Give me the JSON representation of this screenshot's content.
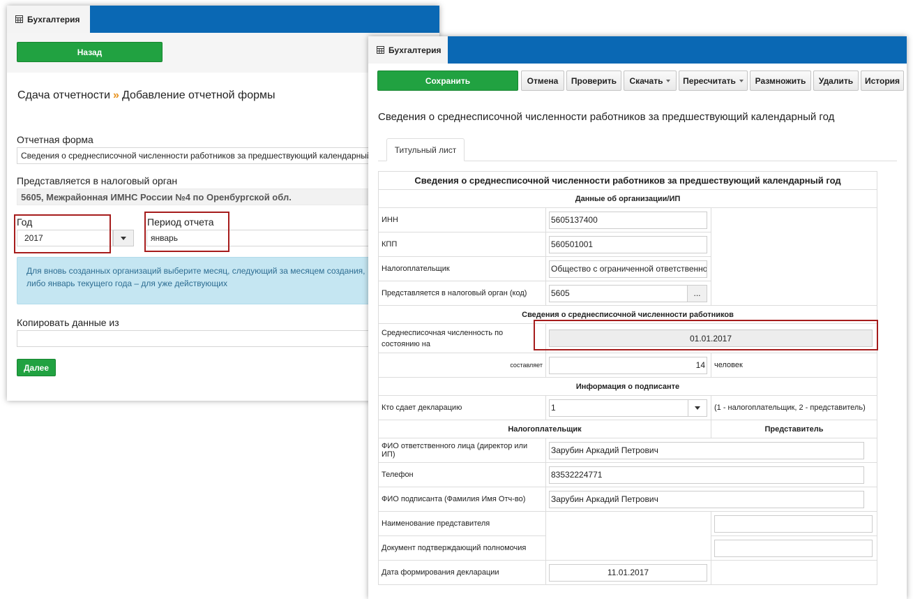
{
  "back_window": {
    "app_name": "Бухгалтерия",
    "back_button": "Назад",
    "breadcrumb": {
      "parent": "Сдача отчетности",
      "separator": "»",
      "current": "Добавление отчетной формы"
    },
    "report_form": {
      "label": "Отчетная форма",
      "value": "Сведения о среднесписочной численности работников за предшествующий календарный год"
    },
    "tax_office": {
      "label": "Представляется в налоговый орган",
      "value": "5605, Межрайонная ИМНС России №4 по Оренбургской обл."
    },
    "year": {
      "label": "Год",
      "value": "2017"
    },
    "period": {
      "label": "Период отчета",
      "value": "январь"
    },
    "info_text": "Для вновь созданных организаций выберите месяц, следующий за месяцем создания, либо январь текущего года – для уже действующих",
    "copy_from": {
      "label": "Копировать данные из",
      "value": ""
    },
    "next_button": "Далее"
  },
  "front_window": {
    "app_name": "Бухгалтерия",
    "toolbar": {
      "save": "Сохранить",
      "cancel": "Отмена",
      "check": "Проверить",
      "download": "Скачать",
      "recalculate": "Пересчитать",
      "duplicate": "Размножить",
      "delete": "Удалить",
      "history": "История"
    },
    "title": "Сведения о среднесписочной численности работников за предшествующий календарный год",
    "tab": "Титульный лист",
    "table": {
      "heading": "Сведения о среднесписочной численности работников за предшествующий календарный год",
      "org_section": "Данные об организации/ИП",
      "inn": {
        "label": "ИНН",
        "value": "5605137400"
      },
      "kpp": {
        "label": "КПП",
        "value": "560501001"
      },
      "taxpayer": {
        "label": "Налогоплательщик",
        "value": "Общество с ограниченной ответственнос"
      },
      "tax_office_code": {
        "label": "Представляется в налоговый орган (код)",
        "value": "5605",
        "button": "..."
      },
      "headcount_section": "Сведения о среднесписочной численности работников",
      "headcount_date": {
        "label": "Среднесписочная численность по состоянию на",
        "value": "01.01.2017"
      },
      "headcount": {
        "label": "составляет",
        "value": "14",
        "unit": "человек"
      },
      "signer_section": "Информация о подписанте",
      "submitter": {
        "label": "Кто сдает декларацию",
        "value": "1",
        "hint": "(1 - налогоплательщик, 2 - представитель)"
      },
      "col_taxpayer": "Налогоплательщик",
      "col_representative": "Представитель",
      "responsible": {
        "label": "ФИО ответственного лица (директор или ИП)",
        "value": "Зарубин Аркадий Петрович"
      },
      "phone": {
        "label": "Телефон",
        "value": "83532224771"
      },
      "signer_name": {
        "label": "ФИО подписанта (Фамилия Имя Отч-во)",
        "value": "Зарубин Аркадий Петрович"
      },
      "rep_name": {
        "label": "Наименование представителя",
        "value": ""
      },
      "rep_doc": {
        "label": "Документ подтверждающий полномочия",
        "value": ""
      },
      "decl_date": {
        "label": "Дата формирования декларации",
        "value": "11.01.2017"
      }
    }
  },
  "colors": {
    "header_blue": "#0a68b4",
    "green_button": "#21a241",
    "highlight_red": "#a61c1c",
    "info_bg": "#c5e6f2",
    "breadcrumb_arrow": "#e8911c"
  }
}
